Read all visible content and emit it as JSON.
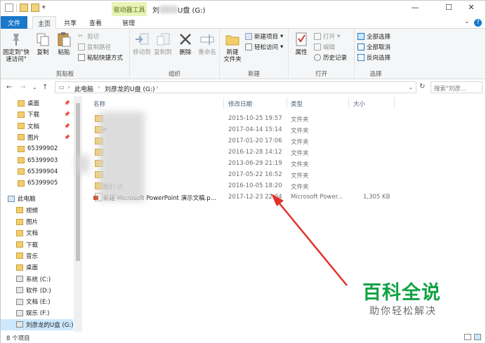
{
  "window": {
    "title": "刘",
    "title_suffix": "U盘 (G:)",
    "context_tab": "驱动器工具",
    "controls": {
      "minimize": "—",
      "maximize": "☐",
      "close": "✕"
    }
  },
  "ribbon_tabs": [
    {
      "label": "文件"
    },
    {
      "label": "主页"
    },
    {
      "label": "共享"
    },
    {
      "label": "查看"
    },
    {
      "label": "管理"
    }
  ],
  "ribbon": {
    "clipboard": {
      "label": "剪贴板",
      "pin": "固定到\"快\n速访问\"",
      "copy": "复制",
      "paste": "粘贴",
      "cut": "剪切",
      "copy_path": "复制路径",
      "paste_shortcut": "粘贴快捷方式"
    },
    "organize": {
      "label": "组织",
      "move_to": "移动到",
      "copy_to": "复制到",
      "delete": "删除",
      "rename": "重命名"
    },
    "new": {
      "label": "新建",
      "new_folder": "新建\n文件夹",
      "new_item": "新建项目",
      "easy_access": "轻松访问"
    },
    "open": {
      "label": "打开",
      "properties": "属性",
      "open": "打开",
      "edit": "编辑",
      "history": "历史记录"
    },
    "select": {
      "label": "选择",
      "select_all": "全部选择",
      "select_none": "全部取消",
      "invert": "反向选择"
    }
  },
  "address": {
    "crumbs": [
      "此电脑",
      "刘彦龙的U盘 (G:)"
    ],
    "search_placeholder": "搜索\"刘彦..."
  },
  "nav": {
    "quick_access": [
      {
        "label": "桌面",
        "pinned": true
      },
      {
        "label": "下载",
        "pinned": true
      },
      {
        "label": "文档",
        "pinned": true
      },
      {
        "label": "图片",
        "pinned": true
      },
      {
        "label": "65399902"
      },
      {
        "label": "65399903"
      },
      {
        "label": "65399904"
      },
      {
        "label": "65399905"
      }
    ],
    "this_pc": "此电脑",
    "pc_items": [
      {
        "label": "视频"
      },
      {
        "label": "图片"
      },
      {
        "label": "文档"
      },
      {
        "label": "下载"
      },
      {
        "label": "音乐"
      },
      {
        "label": "桌面"
      },
      {
        "label": "系统 (C:)"
      },
      {
        "label": "软件 (D:)"
      },
      {
        "label": "文档 (E:)"
      },
      {
        "label": "娱乐 (F:)"
      },
      {
        "label": "刘彦龙的U盘 (G:)"
      }
    ]
  },
  "columns": {
    "name": "名称",
    "date": "修改日期",
    "type": "类型",
    "size": "大小"
  },
  "files": [
    {
      "name": "",
      "date": "2015-10-25 19:57",
      "type": "文件夹",
      "size": "",
      "kind": "folder"
    },
    {
      "name": "e",
      "date": "2017-04-14 15:14",
      "type": "文件夹",
      "size": "",
      "kind": "folder"
    },
    {
      "name": "",
      "date": "2017-01-20 17:06",
      "type": "文件夹",
      "size": "",
      "kind": "folder"
    },
    {
      "name": "",
      "date": "2016-12-28 14:12",
      "type": "文件夹",
      "size": "",
      "kind": "folder"
    },
    {
      "name": "",
      "date": "2013-06-29 21:19",
      "type": "文件夹",
      "size": "",
      "kind": "folder"
    },
    {
      "name": "",
      "date": "2017-05-22 16:52",
      "type": "文件夹",
      "size": "",
      "kind": "folder"
    },
    {
      "name": "我们 过",
      "date": "2016-10-05 18:20",
      "type": "文件夹",
      "size": "",
      "kind": "folder"
    },
    {
      "name": "新建 Microsoft PowerPoint 演示文稿.p...",
      "date": "2017-12-23 22:04",
      "type": "Microsoft Power...",
      "size": "1,305 KB",
      "kind": "ppt"
    }
  ],
  "status": {
    "count": "8 个项目"
  },
  "watermark": {
    "main": "百科全说",
    "sub": "助你轻松解决"
  },
  "colors": {
    "accent": "#1979ca",
    "annotation": "#e0322b",
    "watermark": "#12a244"
  }
}
